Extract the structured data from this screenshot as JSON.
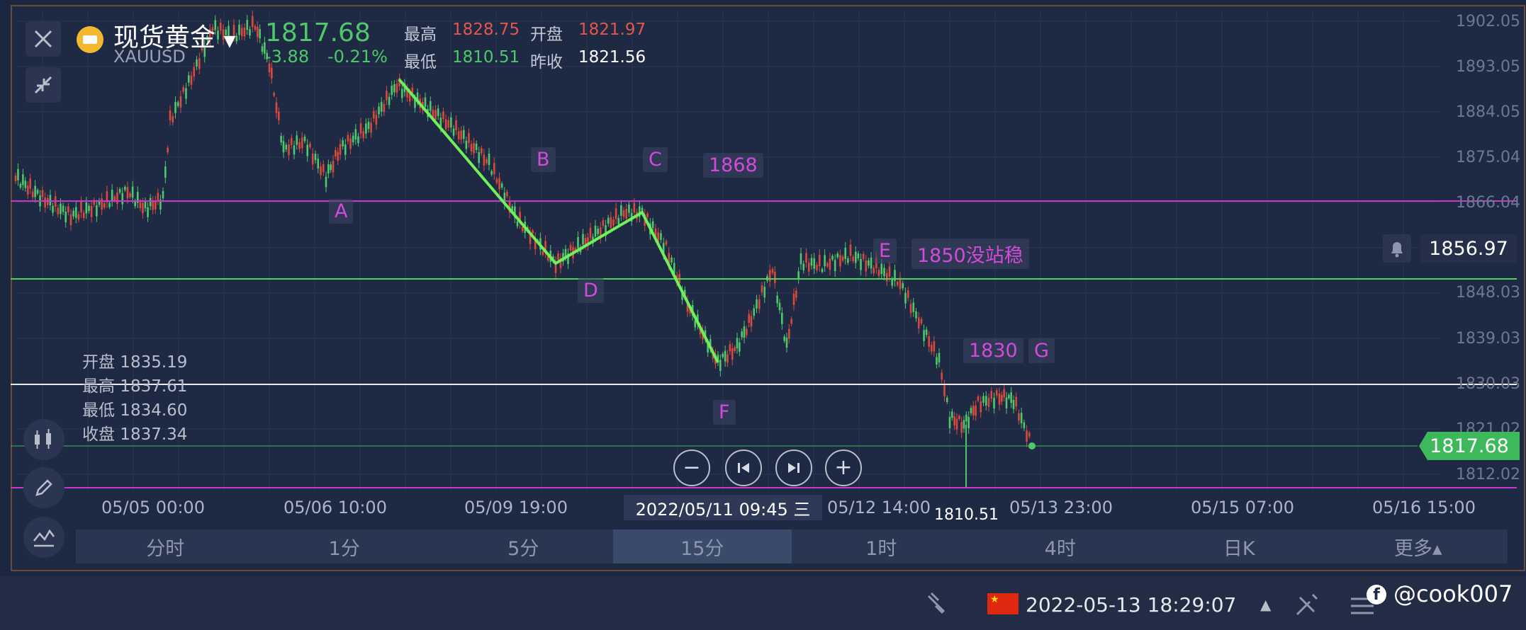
{
  "instrument": {
    "name": "现货黄金",
    "code": "XAUUSD",
    "price": "1817.68",
    "change": "-3.88",
    "change_pct": "-0.21%"
  },
  "quote": {
    "high_label": "最高",
    "high": "1828.75",
    "open_label": "开盘",
    "open": "1821.97",
    "low_label": "最低",
    "low": "1810.51",
    "prev_label": "昨收",
    "prev": "1821.56"
  },
  "ohlc_panel": {
    "open": "开盘 1835.19",
    "high": "最高 1837.61",
    "low": "最低 1834.60",
    "close": "收盘 1837.34"
  },
  "y_axis": [
    "1902.05",
    "1893.05",
    "1884.05",
    "1875.04",
    "1866.04",
    "1848.03",
    "1839.03",
    "1830.03",
    "1821.02",
    "1812.02"
  ],
  "x_axis": [
    "05/05 00:00",
    "05/06 10:00",
    "05/09 19:00",
    "05/12 14:00",
    "05/13 23:00",
    "05/15 07:00",
    "05/16 15:00"
  ],
  "crosshair_time": "2022/05/11 09:45 三",
  "low_marker": "1810.51",
  "bell_price": "1856.97",
  "current_price_tag": "1817.68",
  "annotations": {
    "A": "A",
    "B": "B",
    "C": "C",
    "D": "D",
    "E": "E",
    "F": "F",
    "G": "G",
    "level_1868": "1868",
    "level_1850": "1850没站稳",
    "level_1830": "1830"
  },
  "colors": {
    "up": "#d94a3c",
    "down": "#4ec86b",
    "magenta_line": "#c53ac9",
    "green_line": "#4fd35b",
    "annotation": "#d24bd8",
    "bg": "#1e2944"
  },
  "timeframes": [
    "分时",
    "1分",
    "5分",
    "15分",
    "1时",
    "4时",
    "日K",
    "更多▴"
  ],
  "active_timeframe": "15分",
  "status_bar": {
    "datetime": "2022-05-13 18:29:07",
    "watermark": "@cook007"
  },
  "icons": [
    "close-icon",
    "shrink-icon",
    "candlestick-icon",
    "pencil-icon",
    "indicator-icon",
    "minus-icon",
    "skip-back-icon",
    "skip-forward-icon",
    "plus-icon",
    "bell-icon",
    "flag-cn-icon",
    "facebook-icon",
    "wrench-icon"
  ]
}
